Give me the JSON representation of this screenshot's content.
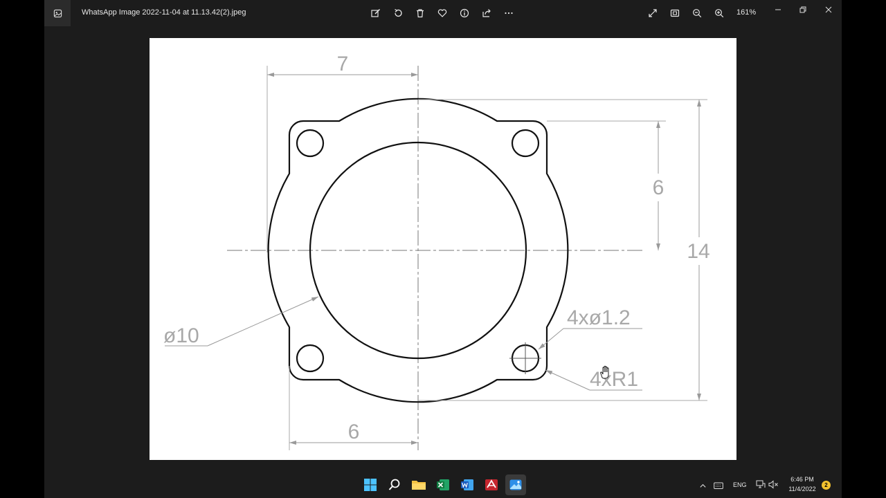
{
  "window": {
    "file_title": "WhatsApp Image 2022-11-04 at 11.13.42(2).jpeg",
    "zoom_level": "161%",
    "toolbar_icons": [
      "edit-image-icon",
      "rotate-icon",
      "delete-icon",
      "favorite-icon",
      "info-icon",
      "share-icon",
      "more-icon"
    ],
    "view_icons": [
      "fullscreen-icon",
      "fit-to-window-icon",
      "zoom-out-icon",
      "zoom-in-icon"
    ]
  },
  "drawing": {
    "dim_width_top": "7",
    "dim_height_inner": "6",
    "dim_height_total": "14",
    "dim_diameter": "ø10",
    "dim_holes": "4xø1.2",
    "dim_fillets": "4xR1",
    "dim_width_bottom": "6"
  },
  "taskbar": {
    "apps": [
      "start-icon",
      "search-icon",
      "file-explorer-icon",
      "excel-icon",
      "word-icon",
      "cad-app-icon",
      "photos-icon"
    ],
    "language": "ENG",
    "time": "6:46 PM",
    "date": "11/4/2022",
    "notification_count": "2"
  }
}
